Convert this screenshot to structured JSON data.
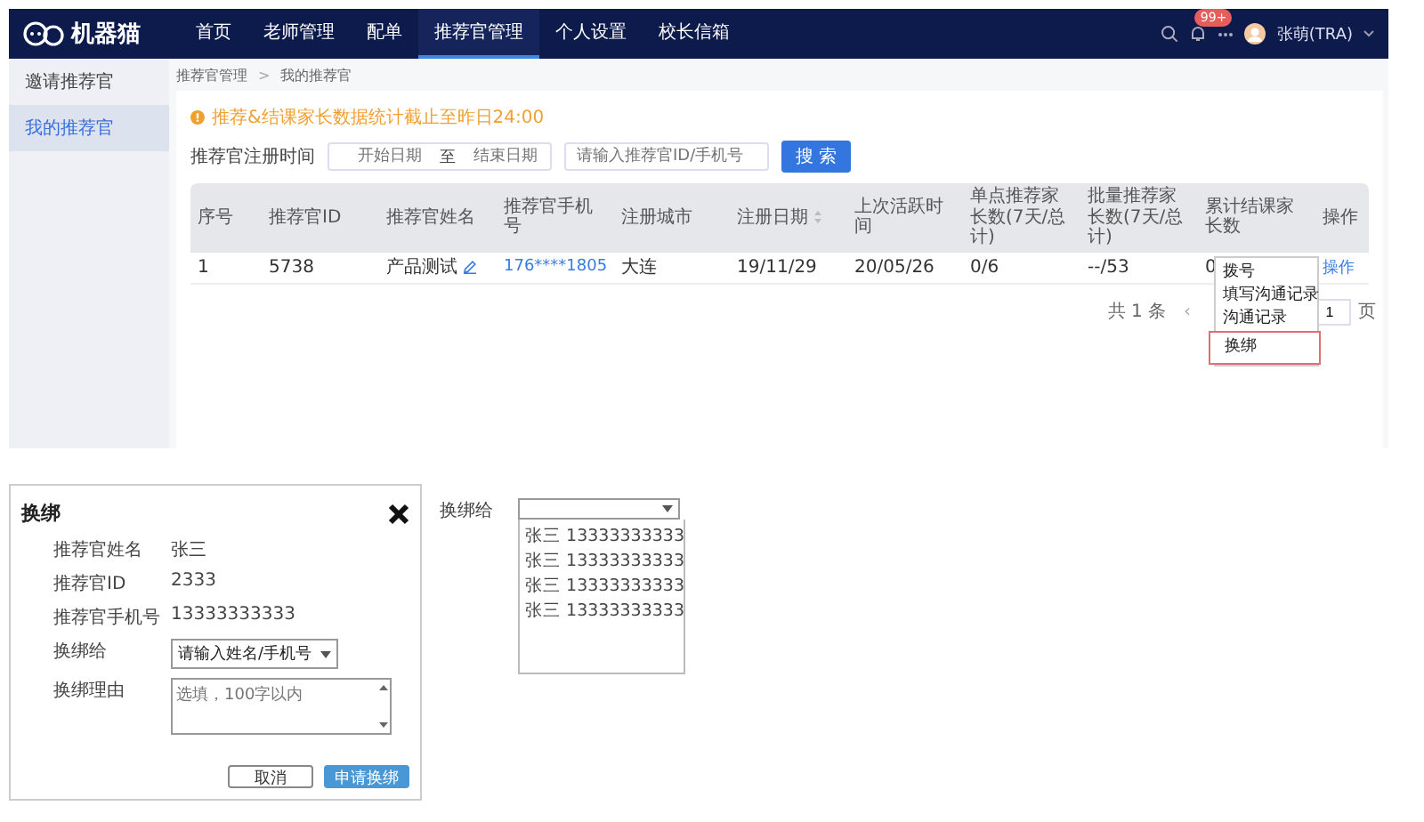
{
  "nav": {
    "logo": "机器猫",
    "items": [
      {
        "label": "首页",
        "selected": false
      },
      {
        "label": "老师管理",
        "selected": false
      },
      {
        "label": "配单",
        "selected": false
      },
      {
        "label": "推荐官管理",
        "selected": true
      },
      {
        "label": "个人设置",
        "selected": false
      },
      {
        "label": "校长信箱",
        "selected": false
      }
    ],
    "badge": "99+",
    "user": "张萌(TRA)"
  },
  "sidebar": {
    "items": [
      {
        "label": "邀请推荐官",
        "selected": false
      },
      {
        "label": "我的推荐官",
        "selected": true
      }
    ]
  },
  "breadcrumb": {
    "items": [
      "推荐官管理",
      "我的推荐官"
    ],
    "separator": ">"
  },
  "notice": "推荐&结课家长数据统计截止至昨日24:00",
  "filter": {
    "label": "推荐官注册时间",
    "start_placeholder": "开始日期",
    "range_separator": "至",
    "end_placeholder": "结束日期",
    "search_placeholder": "请输入推荐官ID/手机号",
    "button": "搜 索"
  },
  "table": {
    "columns": [
      {
        "label": "序号",
        "sortable": false
      },
      {
        "label": "推荐官ID",
        "sortable": false
      },
      {
        "label": "推荐官姓名",
        "sortable": false
      },
      {
        "label": "推荐官手机号",
        "sortable": false
      },
      {
        "label": "注册城市",
        "sortable": false
      },
      {
        "label": "注册日期",
        "sortable": true
      },
      {
        "label": "上次活跃时间",
        "sortable": false
      },
      {
        "label": "单点推荐家长数(7天/总计)",
        "sortable": false
      },
      {
        "label": "批量推荐家长数(7天/总计)",
        "sortable": false
      },
      {
        "label": "累计结课家长数",
        "sortable": false
      },
      {
        "label": "操作",
        "sortable": false
      }
    ],
    "rows": [
      {
        "cells": [
          {
            "text": "1",
            "kind": "text"
          },
          {
            "text": "5738",
            "kind": "text"
          },
          {
            "text": "产品测试",
            "kind": "editable"
          },
          {
            "text": "176****1805",
            "kind": "phone"
          },
          {
            "text": "大连",
            "kind": "text"
          },
          {
            "text": "19/11/29",
            "kind": "text"
          },
          {
            "text": "20/05/26",
            "kind": "text"
          },
          {
            "text": "0/6",
            "kind": "text"
          },
          {
            "text": "--/53",
            "kind": "text"
          },
          {
            "text": "0",
            "kind": "text"
          },
          {
            "text": "操作",
            "kind": "link"
          }
        ]
      }
    ]
  },
  "row_menu": {
    "items": [
      {
        "label": "拨号",
        "selected": false
      },
      {
        "label": "填写沟通记录",
        "selected": false
      },
      {
        "label": "沟通记录",
        "selected": false
      },
      {
        "label": "换绑",
        "selected": true
      }
    ]
  },
  "pagination": {
    "total": "共 1 条",
    "prev": "‹",
    "page": "1",
    "suffix": "页"
  },
  "dialog": {
    "title": "换绑",
    "fields": [
      {
        "label": "推荐官姓名",
        "value": "张三",
        "kind": "text"
      },
      {
        "label": "推荐官ID",
        "value": "2333",
        "kind": "text"
      },
      {
        "label": "推荐官手机号",
        "value": "13333333333",
        "kind": "text"
      },
      {
        "label": "换绑给",
        "value": "请输入姓名/手机号",
        "kind": "select"
      },
      {
        "label": "换绑理由",
        "placeholder": "选填，100字以内",
        "kind": "textarea"
      }
    ],
    "buttons": [
      {
        "label": "取消",
        "kind": "secondary"
      },
      {
        "label": "申请换绑",
        "kind": "primary"
      }
    ]
  },
  "dropdown_demo": {
    "label": "换绑给",
    "options": [
      "张三 13333333333",
      "张三 13333333333",
      "张三 13333333333",
      "张三 13333333333"
    ]
  }
}
